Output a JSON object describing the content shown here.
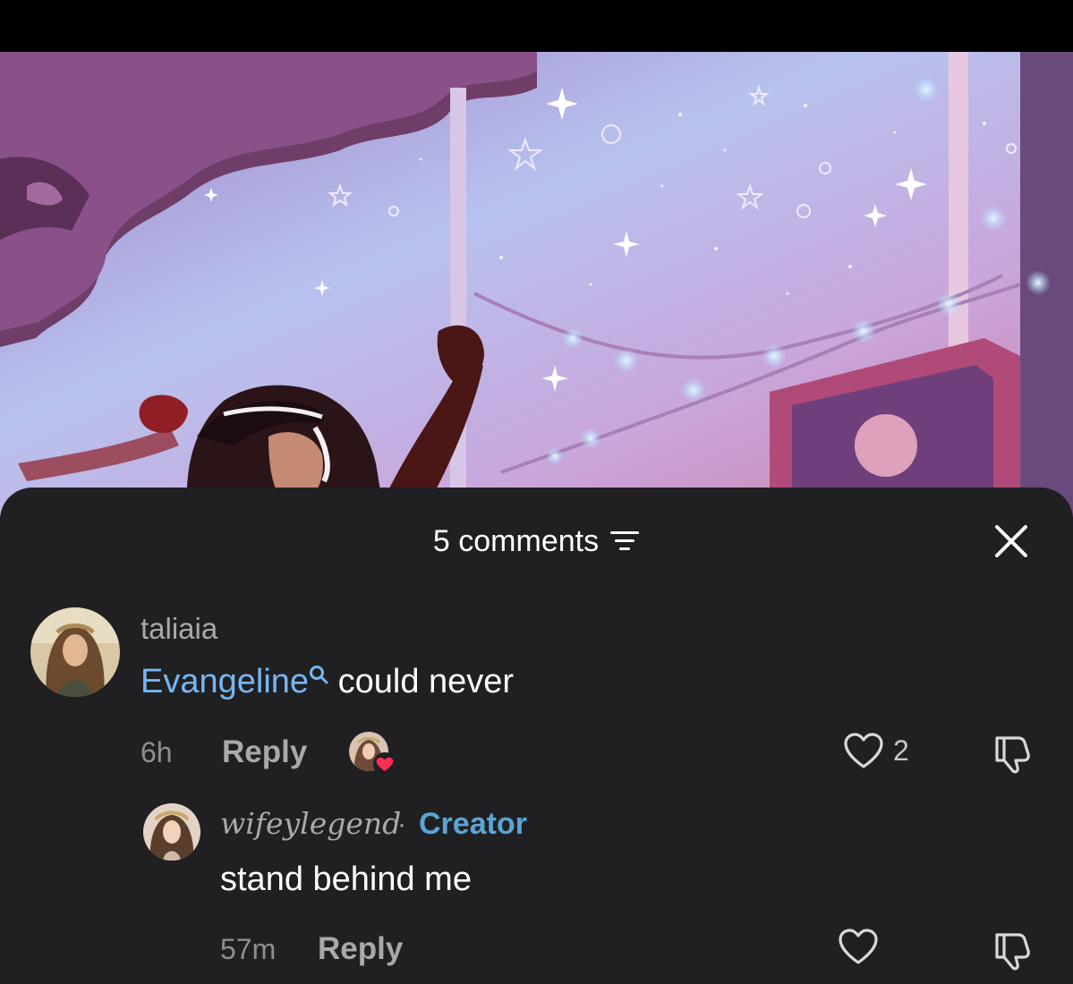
{
  "sheet": {
    "comments_count_label": "5 comments",
    "sort_icon": "sort-lines-icon",
    "close_icon": "close-x-icon"
  },
  "comments": [
    {
      "username": "taliaia",
      "mention": "Evangeline",
      "text": " could never",
      "time": "6h",
      "reply_label": "Reply",
      "like_count": "2",
      "liked_by_creator": true,
      "replies": [
        {
          "username": "wifeylegend",
          "separator": "·",
          "badge": "Creator",
          "text": "stand behind me",
          "time": "57m",
          "reply_label": "Reply"
        }
      ]
    }
  ],
  "colors": {
    "sheet_bg": "#202022",
    "mention": "#78b6f2",
    "creator_badge": "#5aa5d6",
    "heart_badge": "#ff2d55"
  }
}
